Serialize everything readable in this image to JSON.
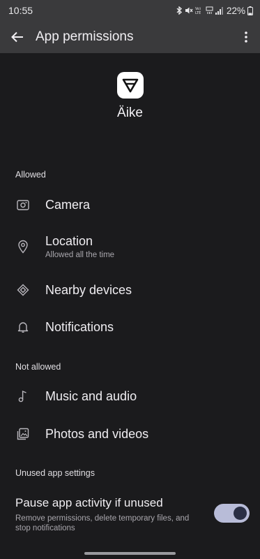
{
  "status_bar": {
    "time": "10:55",
    "battery": "22%",
    "icons": [
      "bluetooth-icon",
      "mute-icon",
      "volte-icon",
      "data-icon",
      "signal-icon",
      "battery-icon"
    ]
  },
  "app_bar": {
    "title": "App permissions",
    "back_icon": "arrow-back-icon",
    "overflow_icon": "more-vert-icon"
  },
  "app": {
    "name": "Äike",
    "icon": "aike-logo"
  },
  "sections": {
    "allowed": "Allowed",
    "not_allowed": "Not allowed",
    "unused": "Unused app settings"
  },
  "allowed": [
    {
      "label": "Camera",
      "sub": "",
      "icon": "camera-icon"
    },
    {
      "label": "Location",
      "sub": "Allowed all the time",
      "icon": "location-icon"
    },
    {
      "label": "Nearby devices",
      "sub": "",
      "icon": "nearby-devices-icon"
    },
    {
      "label": "Notifications",
      "sub": "",
      "icon": "bell-icon"
    }
  ],
  "not_allowed": [
    {
      "label": "Music and audio",
      "icon": "music-icon"
    },
    {
      "label": "Photos and videos",
      "icon": "photos-icon"
    }
  ],
  "unused_settings": {
    "title": "Pause app activity if unused",
    "description": "Remove permissions, delete temporary files, and stop notifications",
    "enabled": true
  },
  "colors": {
    "background": "#1b1b1d",
    "app_bar": "#3a3a3c",
    "toggle_track": "#b8bcd8",
    "toggle_knob": "#2a2f45"
  }
}
